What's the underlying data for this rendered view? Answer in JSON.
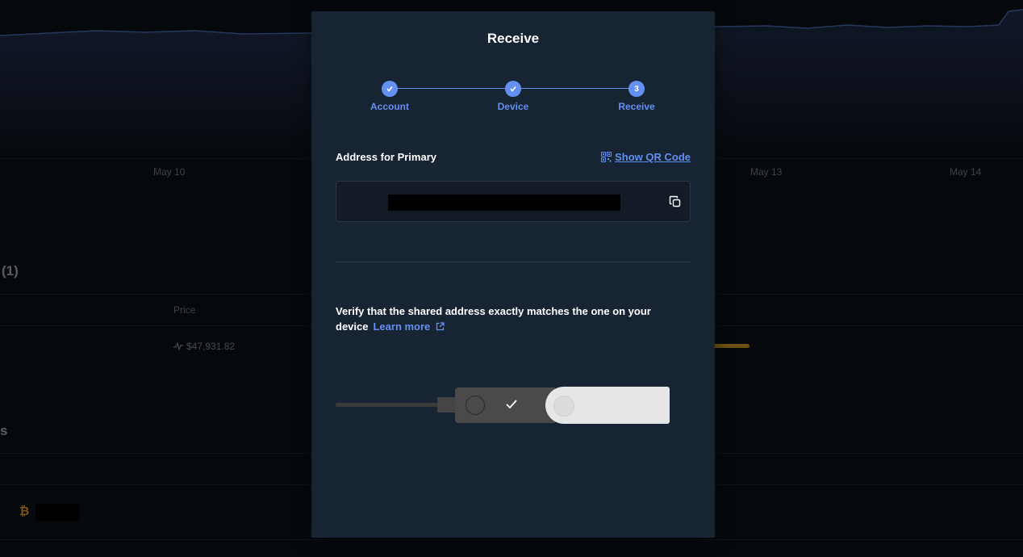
{
  "background": {
    "chart_dates": [
      "May 10",
      "May 13",
      "May 14"
    ],
    "section_count": "(1)",
    "price_header": "Price",
    "price_value": "$47,931.82",
    "section2_partial": "s"
  },
  "modal": {
    "title": "Receive",
    "steps": [
      {
        "label": "Account",
        "state": "done"
      },
      {
        "label": "Device",
        "state": "done"
      },
      {
        "label": "Receive",
        "state": "current",
        "number": "3"
      }
    ],
    "address_label": "Address for Primary",
    "show_qr_label": "Show QR Code",
    "verify_text": "Verify that the shared address exactly matches the one on your device",
    "learn_more_label": "Learn more"
  },
  "colors": {
    "accent": "#6490f1",
    "modal_bg": "#172433",
    "page_bg": "#0a0e13",
    "bitcoin": "#b8821e"
  }
}
